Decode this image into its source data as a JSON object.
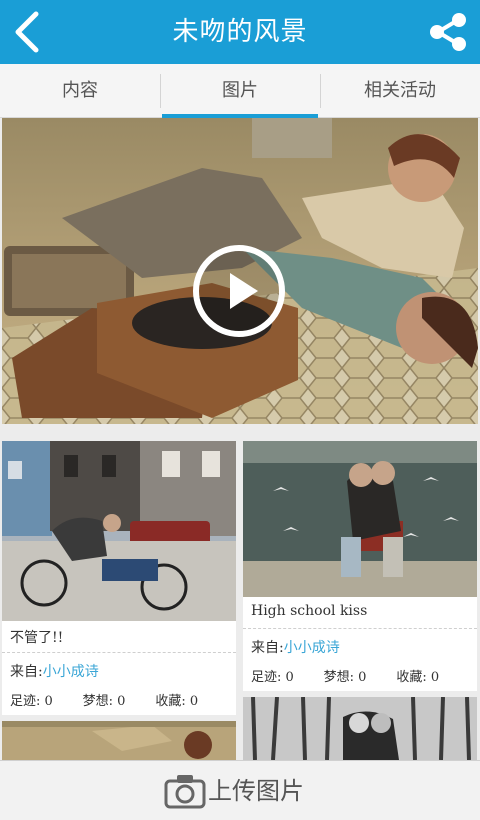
{
  "header": {
    "title": "未吻的风景",
    "back_icon": "chevron-left-icon",
    "share_icon": "share-icon",
    "bg_color": "#1a9ed6"
  },
  "tabs": [
    {
      "label": "内容",
      "active": false
    },
    {
      "label": "图片",
      "active": true
    },
    {
      "label": "相关活动",
      "active": false
    }
  ],
  "hero": {
    "play_icon": "play-icon"
  },
  "cards": [
    {
      "caption": "不管了!!",
      "from_label": "来自:",
      "author": "小小成诗",
      "footprints": "足迹: 0",
      "thoughts": "梦想: 0",
      "favorites": "收藏: 0"
    },
    {
      "caption": "High school kiss",
      "from_label": "来自:",
      "author": "小小成诗",
      "footprints": "足迹: 0",
      "thoughts": "梦想: 0",
      "favorites": "收藏: 0"
    }
  ],
  "bottom_bar": {
    "label": "上传图片",
    "icon": "camera-icon"
  },
  "colors": {
    "accent": "#1a9ed6",
    "author_link": "#3aa6d6"
  }
}
